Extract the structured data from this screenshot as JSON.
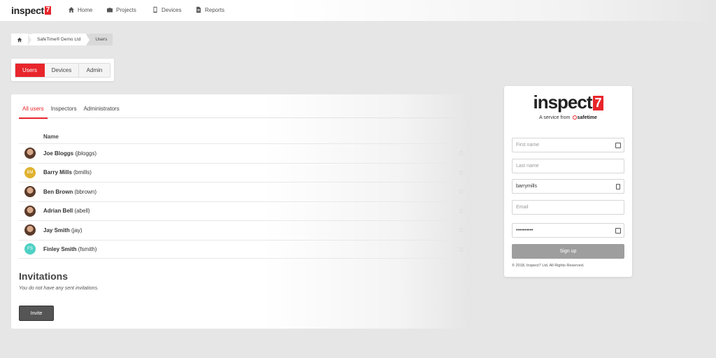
{
  "nav": {
    "logo_text": "inspect",
    "logo_digit": "7",
    "items": [
      {
        "label": "Home",
        "icon": "home-icon"
      },
      {
        "label": "Projects",
        "icon": "briefcase-icon"
      },
      {
        "label": "Devices",
        "icon": "tablet-icon"
      },
      {
        "label": "Reports",
        "icon": "file-icon"
      }
    ]
  },
  "breadcrumb": {
    "home_icon": "home-icon",
    "items": [
      "SafeTime® Demo Ltd",
      "Users"
    ]
  },
  "section_tabs": [
    {
      "label": "Users",
      "active": true
    },
    {
      "label": "Devices",
      "active": false
    },
    {
      "label": "Admin",
      "active": false
    }
  ],
  "user_tabs": [
    {
      "label": "All users",
      "active": true
    },
    {
      "label": "Inspectors",
      "active": false
    },
    {
      "label": "Administrators",
      "active": false
    }
  ],
  "users": {
    "column_header": "Name",
    "rows": [
      {
        "name": "Joe Bloggs",
        "username": "(jbloggs)",
        "avatar": "photo",
        "initials": ""
      },
      {
        "name": "Barry Mills",
        "username": "(bmills)",
        "avatar": "initials",
        "initials": "BM",
        "color": "#e0b22e"
      },
      {
        "name": "Ben Brown",
        "username": "(bbrown)",
        "avatar": "photo",
        "initials": ""
      },
      {
        "name": "Adrian Bell",
        "username": "(abell)",
        "avatar": "photo",
        "initials": ""
      },
      {
        "name": "Jay Smith",
        "username": "(jay)",
        "avatar": "photo",
        "initials": ""
      },
      {
        "name": "Finley Smith",
        "username": "(fsmith)",
        "avatar": "initials",
        "initials": "FS",
        "color": "#4fd1c5"
      }
    ]
  },
  "invitations": {
    "title": "Invitations",
    "empty_text": "You do not have any sent invitations.",
    "invite_label": "Invite"
  },
  "signup": {
    "brand_text": "inspect",
    "brand_digit": "7",
    "tagline_prefix": "A service from",
    "tagline_brand": "safetime",
    "first_name_placeholder": "First name",
    "last_name_placeholder": "Last name",
    "username_value": "barrymills",
    "email_placeholder": "Email",
    "password_value": "••••••••••",
    "button_label": "Sign up",
    "copyright": "© 2018, Inspect7 Ltd. All Rights Reserved."
  },
  "colors": {
    "accent": "#e8252b",
    "button_dark": "#555555",
    "button_disabled": "#9e9e9e"
  }
}
